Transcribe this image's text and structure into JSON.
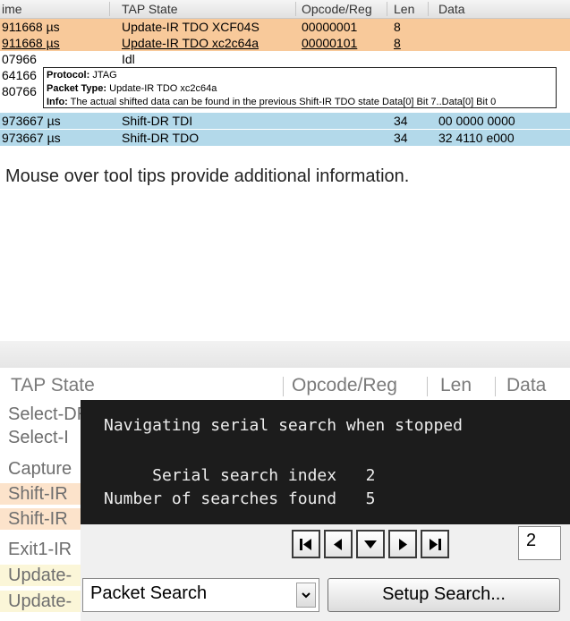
{
  "top_table": {
    "columns": [
      "ime",
      "TAP State",
      "Opcode/Reg",
      "Len",
      "Data"
    ],
    "rows": [
      {
        "time": "911668 µs",
        "state": "Update-IR TDO XCF04S",
        "opcode": "00000001",
        "len": "8",
        "data": ""
      },
      {
        "time": "911668 µs",
        "state": "Update-IR TDO xc2c64a",
        "opcode": "00000101",
        "len": "8",
        "data": ""
      },
      {
        "time": "07966",
        "state": "Idl",
        "opcode": "",
        "len": "",
        "data": ""
      },
      {
        "time": "64166",
        "state": "",
        "opcode": "",
        "len": "",
        "data": ""
      },
      {
        "time": "80766",
        "state": "",
        "opcode": "",
        "len": "",
        "data": ""
      },
      {
        "time": "973667 µs",
        "state": "Shift-DR TDI",
        "opcode": "",
        "len": "34",
        "data": "00 0000 0000"
      },
      {
        "time": "973667 µs",
        "state": "Shift-DR TDO",
        "opcode": "",
        "len": "34",
        "data": "32 4110 e000"
      }
    ]
  },
  "tooltip": {
    "protocol_label": "Protocol:",
    "protocol_value": " JTAG",
    "packet_type_label": "Packet Type:",
    "packet_type_value": " Update-IR TDO xc2c64a",
    "info_label": "Info:",
    "info_value": " The actual shifted data can be found in the previous Shift-IR TDO state Data[0] Bit 7..Data[0] Bit 0"
  },
  "caption": "Mouse over tool tips provide additional information.",
  "bottom_table": {
    "columns": [
      "TAP State",
      "Opcode/Reg",
      "Len",
      "Data"
    ],
    "rows": [
      "Select-DR",
      "Select-I",
      "Capture",
      "Shift-IR",
      "Shift-IR",
      "Exit1-IR",
      "Update-",
      "Update-"
    ]
  },
  "overlay": {
    "title": "Navigating serial search when stopped",
    "line1": "     Serial search index   2",
    "line2": "Number of searches found   5"
  },
  "controls": {
    "first_icon": "skip-first-icon",
    "prev_icon": "previous-icon",
    "down_icon": "down-icon",
    "next_icon": "next-icon",
    "last_icon": "skip-last-icon",
    "index_value": "2",
    "select_value": "Packet Search",
    "setup_label": "Setup Search..."
  }
}
